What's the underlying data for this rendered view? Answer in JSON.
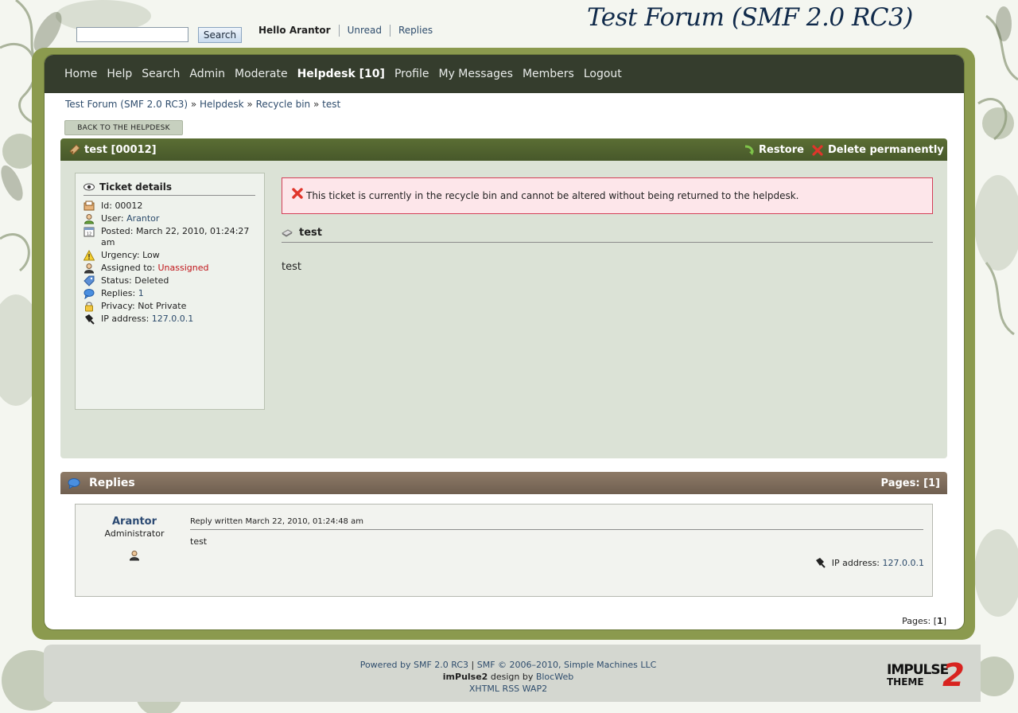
{
  "header": {
    "search_button": "Search",
    "hello": "Hello Arantor",
    "links": [
      "Unread",
      "Replies"
    ],
    "forum_title": "Test Forum (SMF 2.0 RC3)"
  },
  "nav": {
    "items": [
      "Home",
      "Help",
      "Search",
      "Admin",
      "Moderate",
      "Helpdesk [10]",
      "Profile",
      "My Messages",
      "Members",
      "Logout"
    ]
  },
  "breadcrumb": {
    "items": [
      "Test Forum (SMF 2.0 RC3)",
      "Helpdesk",
      "Recycle bin",
      "test"
    ],
    "separator": "»"
  },
  "back_button": "BACK TO THE HELPDESK",
  "ticket": {
    "title": "test [00012]",
    "actions": {
      "restore": "Restore",
      "delete": "Delete permanently"
    },
    "details_heading": "Ticket details",
    "details": {
      "id_label": "Id:",
      "id": "00012",
      "user_label": "User:",
      "user": "Arantor",
      "posted_label": "Posted:",
      "posted": "March 22, 2010, 01:24:27 am",
      "urgency_label": "Urgency:",
      "urgency": "Low",
      "assigned_label": "Assigned to:",
      "assigned": "Unassigned",
      "status_label": "Status:",
      "status": "Deleted",
      "replies_label": "Replies:",
      "replies": "1",
      "privacy_label": "Privacy:",
      "privacy": "Not Private",
      "ip_label": "IP address:",
      "ip": "127.0.0.1"
    },
    "alert": "This ticket is currently in the recycle bin and cannot be altered without being returned to the helpdesk.",
    "subject": "test",
    "body": "test"
  },
  "replies": {
    "title": "Replies",
    "pages_label": "Pages:",
    "page_current": "[1]",
    "reply": {
      "author": "Arantor",
      "role": "Administrator",
      "meta": "Reply written March 22, 2010, 01:24:48 am",
      "text": "test",
      "ip_label": "IP address:",
      "ip": "127.0.0.1"
    },
    "bottom_pages_label": "Pages:",
    "bottom_page_current": "1"
  },
  "footer": {
    "powered_prefix": "Powered by",
    "smf_version": "SMF 2.0 RC3",
    "copyright": "SMF © 2006–2010, Simple Machines LLC",
    "theme_name": "imPulse2",
    "design_by": "design by",
    "designer": "BlocWeb",
    "links": [
      "XHTML",
      "RSS",
      "WAP2"
    ],
    "logo_top": "IMPULSE",
    "logo_bottom": "THEME",
    "logo_num": "2"
  },
  "colors": {
    "nav_bg": "#353d2d",
    "ticket_bar": "#4f612d",
    "replies_bar": "#7d6c5b",
    "alert_bg": "#fde6ea",
    "alert_border": "#d33f58",
    "unassigned": "#c0151a"
  }
}
